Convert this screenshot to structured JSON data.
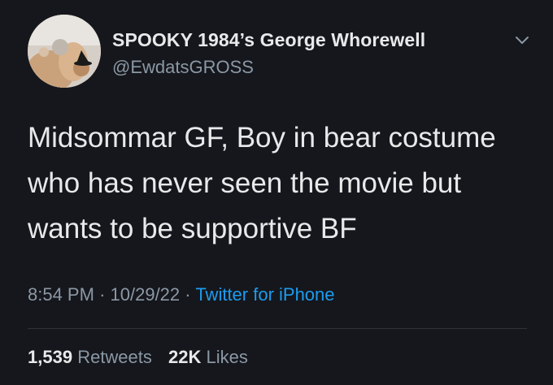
{
  "tweet": {
    "author": {
      "display_name": "SPOOKY 1984’s George Whorewell",
      "handle": "@EwdatsGROSS"
    },
    "text_lines": [
      "Midsommar GF, Boy in bear costume",
      "who has never seen the movie but",
      "wants to be supportive BF"
    ],
    "time": "8:54 PM",
    "date": "10/29/22",
    "separator": "·",
    "source": "Twitter for iPhone",
    "retweets": {
      "count": "1,539",
      "label": "Retweets"
    },
    "likes": {
      "count": "22K",
      "label": "Likes"
    }
  },
  "colors": {
    "background": "#15171c",
    "text": "#e7e9ea",
    "secondary": "#8b98a5",
    "link": "#1d9bf0"
  },
  "icons": {
    "menu": "chevron-down-icon"
  }
}
